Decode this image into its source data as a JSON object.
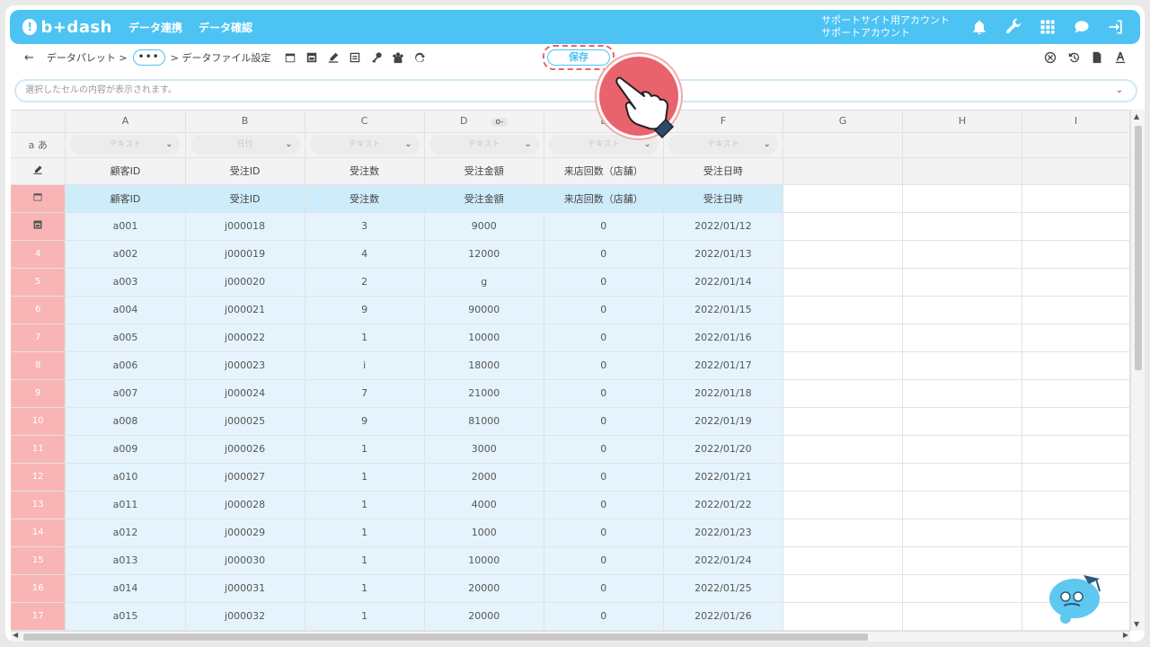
{
  "header": {
    "logo_text": "b+dash",
    "nav": [
      "データ連携",
      "データ確認"
    ],
    "account_line1": "サポートサイト用アカウント",
    "account_line2": "サポートアカウント",
    "icons": [
      "bell-icon",
      "wrench-icon",
      "grid-icon",
      "chat-icon",
      "logout-icon"
    ]
  },
  "toolbar": {
    "back": "←",
    "crumb_palette": "データパレット >",
    "crumb_ellipsis": "•••",
    "crumb_current": "> データファイル設定",
    "save_label": "保存",
    "left_icons": [
      "calendar-icon",
      "table-icon",
      "edit-icon",
      "text-icon",
      "key-icon",
      "group-icon",
      "refresh-icon"
    ],
    "right_icons": [
      "close-circle-icon",
      "history-icon",
      "file-icon",
      "font-icon"
    ]
  },
  "cellbar": {
    "placeholder": "選択したセルの内容が表示されます。",
    "chevron": "⌄"
  },
  "grid": {
    "corner_label": "",
    "type_row_label": "a あ",
    "columns": [
      "A",
      "B",
      "C",
      "D",
      "E",
      "F",
      "G",
      "H",
      "I"
    ],
    "key_mark": "o-",
    "types": [
      "テキスト",
      "日付",
      "テキスト",
      "テキスト",
      "テキスト",
      "テキスト"
    ],
    "name_row": [
      "顧客ID",
      "受注ID",
      "受注数",
      "受注金額",
      "来店回数（店舗）",
      "受注日時"
    ],
    "header_row": [
      "顧客ID",
      "受注ID",
      "受注数",
      "受注金額",
      "来店回数（店舗）",
      "受注日時"
    ],
    "rows": [
      {
        "num": "",
        "cells": [
          "a001",
          "j000018",
          "3",
          "9000",
          "0",
          "2022/01/12"
        ]
      },
      {
        "num": "4",
        "cells": [
          "a002",
          "j000019",
          "4",
          "12000",
          "0",
          "2022/01/13"
        ]
      },
      {
        "num": "5",
        "cells": [
          "a003",
          "j000020",
          "2",
          "g",
          "0",
          "2022/01/14"
        ]
      },
      {
        "num": "6",
        "cells": [
          "a004",
          "j000021",
          "9",
          "90000",
          "0",
          "2022/01/15"
        ]
      },
      {
        "num": "7",
        "cells": [
          "a005",
          "j000022",
          "1",
          "10000",
          "0",
          "2022/01/16"
        ]
      },
      {
        "num": "8",
        "cells": [
          "a006",
          "j000023",
          "i",
          "18000",
          "0",
          "2022/01/17"
        ]
      },
      {
        "num": "9",
        "cells": [
          "a007",
          "j000024",
          "7",
          "21000",
          "0",
          "2022/01/18"
        ]
      },
      {
        "num": "10",
        "cells": [
          "a008",
          "j000025",
          "9",
          "81000",
          "0",
          "2022/01/19"
        ]
      },
      {
        "num": "11",
        "cells": [
          "a009",
          "j000026",
          "1",
          "3000",
          "0",
          "2022/01/20"
        ]
      },
      {
        "num": "12",
        "cells": [
          "a010",
          "j000027",
          "1",
          "2000",
          "0",
          "2022/01/21"
        ]
      },
      {
        "num": "13",
        "cells": [
          "a011",
          "j000028",
          "1",
          "4000",
          "0",
          "2022/01/22"
        ]
      },
      {
        "num": "14",
        "cells": [
          "a012",
          "j000029",
          "1",
          "1000",
          "0",
          "2022/01/23"
        ]
      },
      {
        "num": "15",
        "cells": [
          "a013",
          "j000030",
          "1",
          "10000",
          "0",
          "2022/01/24"
        ]
      },
      {
        "num": "16",
        "cells": [
          "a014",
          "j000031",
          "1",
          "20000",
          "0",
          "2022/01/25"
        ]
      },
      {
        "num": "17",
        "cells": [
          "a015",
          "j000032",
          "1",
          "20000",
          "0",
          "2022/01/26"
        ]
      }
    ]
  },
  "colors": {
    "brand": "#4cc3f3",
    "highlight": "#e8636b",
    "row_header_pink": "#f9b5b6",
    "data_bg": "#e5f4fc"
  }
}
